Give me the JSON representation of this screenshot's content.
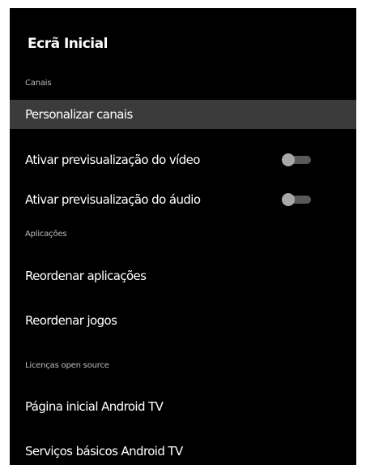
{
  "settings": {
    "title": "Ecrã Inicial",
    "sections": {
      "channels": "Canais",
      "apps": "Aplicações",
      "licenses": "Licenças open source"
    },
    "items": {
      "customize_channels": "Personalizar canais",
      "video_preview": "Ativar previsualização do vídeo",
      "audio_preview": "Ativar previsualização do áudio",
      "reorder_apps": "Reordenar aplicações",
      "reorder_games": "Reordenar jogos",
      "android_tv_home": "Página inicial Android TV",
      "android_tv_core": "Serviços básicos Android TV"
    },
    "toggles": {
      "video_preview_enabled": false,
      "audio_preview_enabled": false
    },
    "colors": {
      "panel_background": "#000000",
      "focus_highlight": "#3b3b3b",
      "section_text": "#bdbdbd",
      "toggle_track_off": "#595959",
      "toggle_thumb_off": "#a8a8a8"
    }
  }
}
